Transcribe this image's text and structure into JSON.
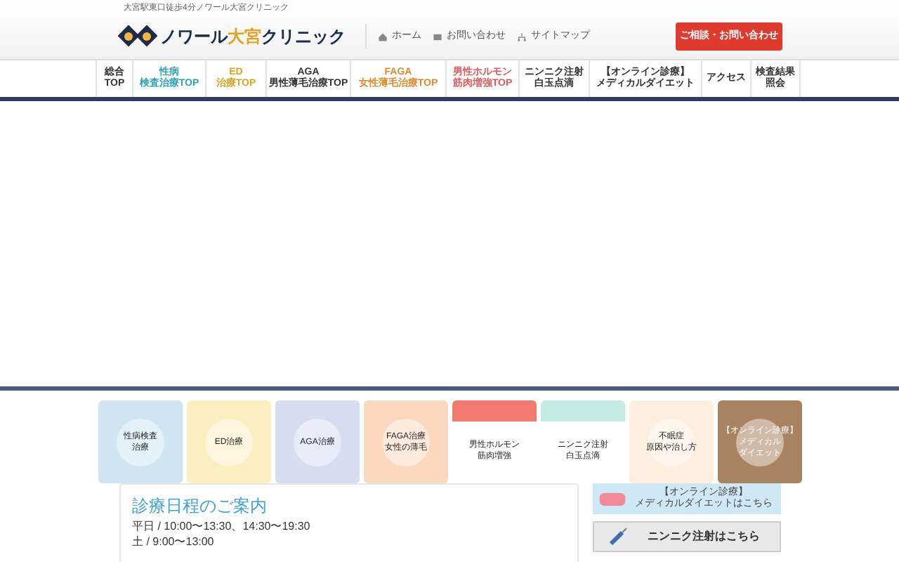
{
  "tagline": "大宮駅東口徒歩4分ノワール大宮クリニック",
  "logo": {
    "name_part1": "ノワール",
    "name_part2": "大宮",
    "name_part3": "クリニック"
  },
  "header_links": [
    {
      "label": "ホーム",
      "kind": "home"
    },
    {
      "label": "お問い合わせ",
      "kind": "mail"
    },
    {
      "label": "サイトマップ",
      "kind": "sitemap"
    }
  ],
  "contact_button": "ご相談・お問い合わせ",
  "nav": [
    {
      "lines": [
        "総合",
        "TOP"
      ],
      "color": "#333333"
    },
    {
      "lines": [
        "性病",
        "検査治療TOP"
      ],
      "color": "#2aa3b8"
    },
    {
      "lines": [
        "ED",
        "治療TOP"
      ],
      "color": "#d9a520"
    },
    {
      "lines": [
        "AGA",
        "男性薄毛治療TOP"
      ],
      "color": "#333333"
    },
    {
      "lines": [
        "FAGA",
        "女性薄毛治療TOP"
      ],
      "color": "#e08a2a"
    },
    {
      "lines": [
        "男性ホルモン",
        "筋肉増強TOP"
      ],
      "color": "#e05a5a"
    },
    {
      "lines": [
        "ニンニク注射",
        "白玉点滴"
      ],
      "color": "#333333"
    },
    {
      "lines": [
        "【オンライン診療】",
        "メディカルダイエット"
      ],
      "color": "#333333"
    },
    {
      "lines": [
        "アクセス"
      ],
      "color": "#333333"
    },
    {
      "lines": [
        "検査結果",
        "照会"
      ],
      "color": "#333333"
    }
  ],
  "tiles": [
    {
      "kind": "full",
      "color": "#cfe6f2",
      "lines": [
        "性病検査",
        "治療"
      ]
    },
    {
      "kind": "full",
      "color": "#fbefc0",
      "lines": [
        "ED治療"
      ]
    },
    {
      "kind": "full",
      "color": "#d8dcf0",
      "lines": [
        "AGA治療"
      ]
    },
    {
      "kind": "full",
      "color": "#fbd9c0",
      "lines": [
        "FAGA治療",
        "女性の薄毛"
      ]
    },
    {
      "kind": "banner",
      "color": "#f07a70",
      "lines": [
        "男性ホルモン",
        "筋肉増強"
      ]
    },
    {
      "kind": "banner",
      "color": "#c5ece4",
      "lines": [
        "ニンニク注射",
        "白玉点滴"
      ]
    },
    {
      "kind": "full",
      "color": "#fdeedd",
      "lines": [
        "不眠症",
        "原因や治し方"
      ]
    },
    {
      "kind": "full",
      "color": "#a8835f",
      "lines": [
        "【オンライン診療】",
        "メディカル",
        "ダイエット"
      ]
    }
  ],
  "schedule": {
    "title": "診療日程のご案内",
    "rows": [
      "平日 / 10:00〜13:30、14:30〜19:30",
      "土 / 9:00〜13:00"
    ]
  },
  "side_banners": [
    {
      "kind": "online",
      "lines": [
        "【オンライン診療】",
        "メディカルダイエットはこちら"
      ]
    },
    {
      "kind": "garlic",
      "lines": [
        "ニンニク注射はこちら"
      ]
    }
  ]
}
